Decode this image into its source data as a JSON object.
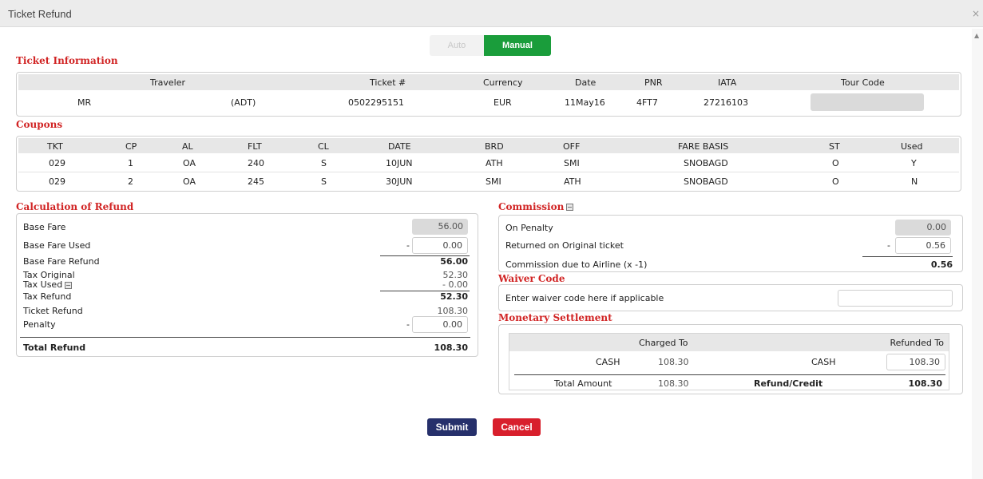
{
  "window": {
    "title": "Ticket Refund",
    "close": "×"
  },
  "mode": {
    "auto": "Auto",
    "manual": "Manual",
    "selected": "Manual"
  },
  "ticket_info": {
    "title": "Ticket Information",
    "headers": {
      "traveler": "Traveler",
      "ticket": "Ticket #",
      "currency": "Currency",
      "date": "Date",
      "pnr": "PNR",
      "iata": "IATA",
      "tour_code": "Tour Code"
    },
    "row": {
      "title": "MR",
      "pax_type": "(ADT)",
      "ticket": "0502295151",
      "currency": "EUR",
      "date": "11May16",
      "pnr": "4FT7",
      "iata": "27216103",
      "tour_code": ""
    }
  },
  "coupons": {
    "title": "Coupons",
    "headers": [
      "TKT",
      "CP",
      "AL",
      "FLT",
      "CL",
      "DATE",
      "BRD",
      "OFF",
      "FARE BASIS",
      "ST",
      "Used"
    ],
    "rows": [
      [
        "029",
        "1",
        "OA",
        "240",
        "S",
        "10JUN",
        "ATH",
        "SMI",
        "SNOBAGD",
        "O",
        "Y"
      ],
      [
        "029",
        "2",
        "OA",
        "245",
        "S",
        "30JUN",
        "SMI",
        "ATH",
        "SNOBAGD",
        "O",
        "N"
      ]
    ]
  },
  "calc": {
    "title": "Calculation of Refund",
    "base_fare_label": "Base Fare",
    "base_fare": "56.00",
    "base_fare_used_label": "Base Fare Used",
    "base_fare_used": "0.00",
    "minus": "-",
    "base_fare_refund_label": "Base Fare Refund",
    "base_fare_refund": "56.00",
    "tax_original_label": "Tax Original",
    "tax_original": "52.30",
    "tax_used_label": "Tax Used",
    "tax_used": "- 0.00",
    "tax_refund_label": "Tax Refund",
    "tax_refund": "52.30",
    "ticket_refund_label": "Ticket Refund",
    "ticket_refund": "108.30",
    "penalty_label": "Penalty",
    "penalty": "0.00",
    "total_refund_label": "Total Refund",
    "total_refund": "108.30"
  },
  "commission": {
    "title": "Commission",
    "on_penalty_label": "On Penalty",
    "on_penalty": "0.00",
    "returned_label": "Returned on Original ticket",
    "returned": "0.56",
    "minus": "-",
    "due_label": "Commission due to Airline (x -1)",
    "due": "0.56"
  },
  "waiver": {
    "title": "Waiver Code",
    "label": "Enter waiver code here if applicable",
    "value": ""
  },
  "settlement": {
    "title": "Monetary Settlement",
    "charged_to": "Charged To",
    "refunded_to": "Refunded To",
    "charged_method": "CASH",
    "charged_amount": "108.30",
    "refund_method": "CASH",
    "refund_amount": "108.30",
    "total_amount_label": "Total Amount",
    "total_amount": "108.30",
    "refund_credit_label": "Refund/Credit",
    "refund_credit": "108.30"
  },
  "buttons": {
    "submit": "Submit",
    "cancel": "Cancel"
  }
}
